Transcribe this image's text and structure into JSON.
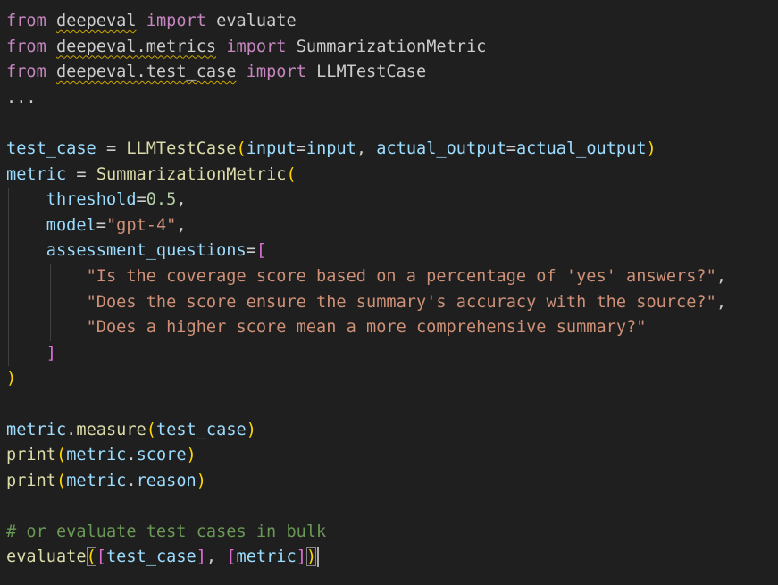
{
  "code": {
    "import1": {
      "from": "from",
      "module": "deepeval",
      "import": "import",
      "name": "evaluate"
    },
    "import2": {
      "from": "from",
      "module": "deepeval.metrics",
      "import": "import",
      "name": "SummarizationMetric"
    },
    "import3": {
      "from": "from",
      "module": "deepeval.test_case",
      "import": "import",
      "name": "LLMTestCase"
    },
    "ellipsis": "...",
    "test_case_line": {
      "var": "test_case",
      "eq": " = ",
      "cls": "LLMTestCase",
      "p1": "input",
      "v1": "input",
      "p2": "actual_output",
      "v2": "actual_output"
    },
    "metric_line": {
      "var": "metric",
      "eq": " = ",
      "cls": "SummarizationMetric"
    },
    "threshold": {
      "param": "threshold",
      "value": "0.5"
    },
    "model": {
      "param": "model",
      "value": "\"gpt-4\""
    },
    "assessment": {
      "param": "assessment_questions"
    },
    "questions": [
      "\"Is the coverage score based on a percentage of 'yes' answers?\"",
      "\"Does the score ensure the summary's accuracy with the source?\"",
      "\"Does a higher score mean a more comprehensive summary?\""
    ],
    "measure_line": {
      "obj": "metric",
      "method": "measure",
      "arg": "test_case"
    },
    "print_score": {
      "fn": "print",
      "obj": "metric",
      "attr": "score"
    },
    "print_reason": {
      "fn": "print",
      "obj": "metric",
      "attr": "reason"
    },
    "comment": "# or evaluate test cases in bulk",
    "evaluate_line": {
      "fn": "evaluate",
      "arg1": "test_case",
      "arg2": "metric"
    }
  },
  "colors": {
    "background": "#1f1f1f",
    "keyword": "#c586c0",
    "function": "#dcdcaa",
    "variable": "#9cdcfe",
    "string": "#ce9178",
    "number": "#b5cea8",
    "comment": "#6a9955",
    "bracket_level1": "#ffd700",
    "bracket_level2": "#da70d6",
    "bracket_level3": "#179fff"
  }
}
